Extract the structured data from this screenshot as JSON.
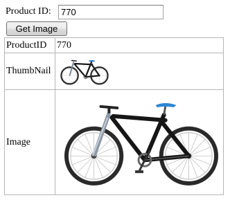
{
  "form": {
    "id_label": "Product ID:",
    "id_value": "770",
    "button_label": "Get Image"
  },
  "table": {
    "rows": [
      {
        "label": "ProductID",
        "value": "770"
      },
      {
        "label": "ThumbNail"
      },
      {
        "label": "Image"
      }
    ]
  },
  "colors": {
    "frame": "#1a1a1a",
    "accent": "#3a8fd8",
    "tire": "#2a2a2a",
    "spoke": "#b8b8b8"
  },
  "images": {
    "thumbnail": "mountain-bike-thumbnail",
    "large": "mountain-bike-photo"
  }
}
